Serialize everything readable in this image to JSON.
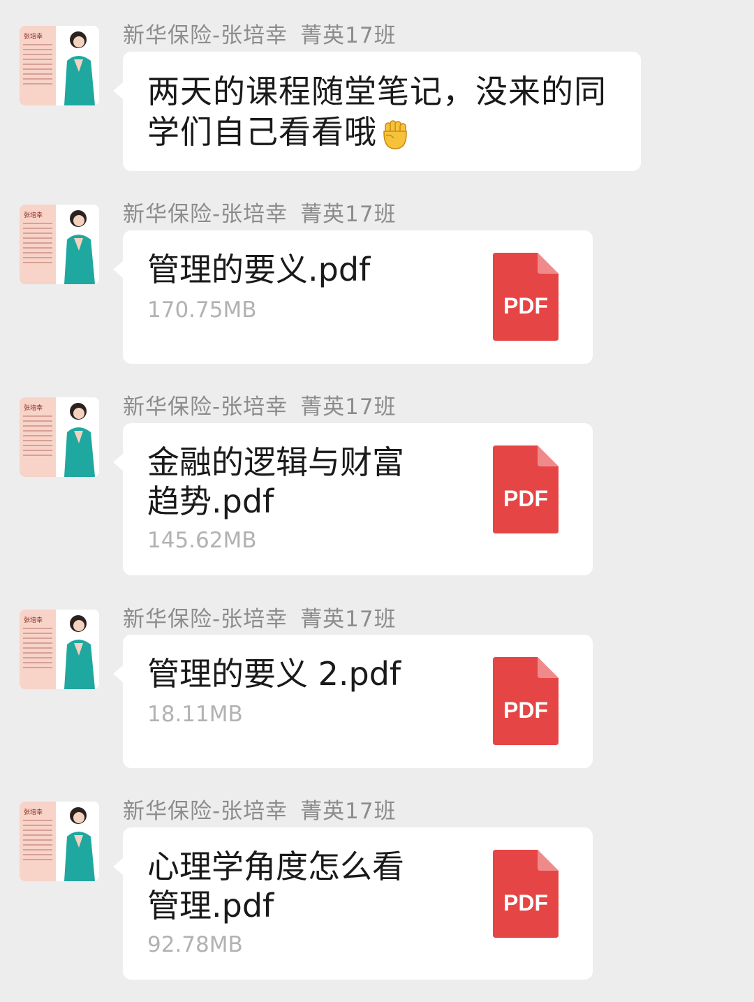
{
  "chat": {
    "messages": [
      {
        "sender": "新华保险-张培幸",
        "group": "菁英17班",
        "type": "text",
        "text_line1": "两天的课程随堂笔记，没来的同",
        "text_line2": "学们自己看看哦",
        "emoji": "raised-fist-emoji"
      },
      {
        "sender": "新华保险-张培幸",
        "group": "菁英17班",
        "type": "file",
        "file_name": "管理的要义.pdf",
        "file_size": "170.75MB",
        "file_icon_label": "PDF"
      },
      {
        "sender": "新华保险-张培幸",
        "group": "菁英17班",
        "type": "file",
        "file_name": "金融的逻辑与财富趋势.pdf",
        "file_size": "145.62MB",
        "file_icon_label": "PDF"
      },
      {
        "sender": "新华保险-张培幸",
        "group": "菁英17班",
        "type": "file",
        "file_name": "管理的要义 2.pdf",
        "file_size": "18.11MB",
        "file_icon_label": "PDF"
      },
      {
        "sender": "新华保险-张培幸",
        "group": "菁英17班",
        "type": "file",
        "file_name": "心理学角度怎么看管理.pdf",
        "file_size": "92.78MB",
        "file_icon_label": "PDF"
      }
    ],
    "avatar_card_name": "张培幸"
  },
  "colors": {
    "background": "#ededed",
    "bubble": "#ffffff",
    "pdf_red": "#e64545",
    "sender_text": "#8c8c8c",
    "size_text": "#b2b2b2"
  }
}
